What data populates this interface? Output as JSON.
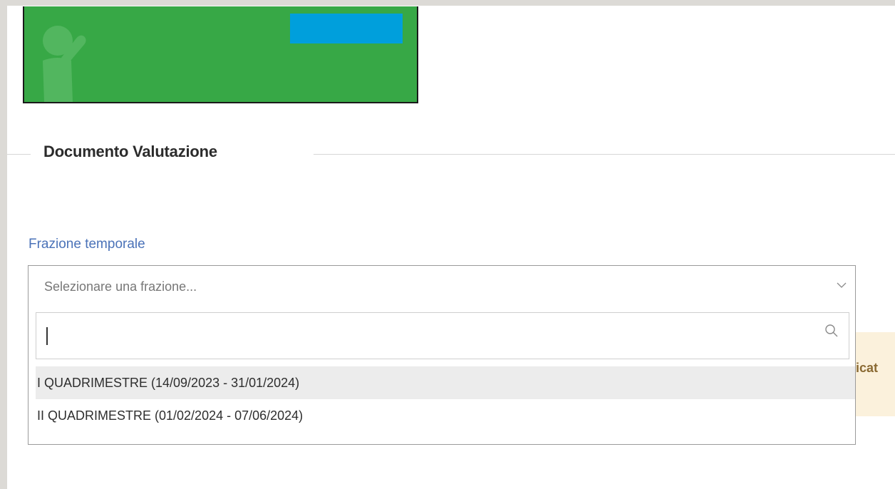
{
  "section": {
    "title": "Documento Valutazione"
  },
  "field": {
    "label": "Frazione temporale",
    "placeholder": "Selezionare una frazione...",
    "search_value": "",
    "options": [
      {
        "label": "I QUADRIMESTRE (14/09/2023 - 31/01/2024)",
        "highlighted": true
      },
      {
        "label": "II QUADRIMESTRE (01/02/2024 - 07/06/2024)",
        "highlighted": false
      }
    ]
  },
  "notice": {
    "text": "nicat"
  },
  "icons": {
    "dropdown": "chevron-down-icon",
    "search": "search-icon",
    "banner_figure": "person-waving-icon"
  },
  "colors": {
    "banner_green": "#37a846",
    "banner_blue": "#009fdc",
    "label_blue": "#4a72b8",
    "notice_bg": "#fbf1dc",
    "notice_text": "#8a6a33",
    "highlight_row": "#ececec"
  }
}
